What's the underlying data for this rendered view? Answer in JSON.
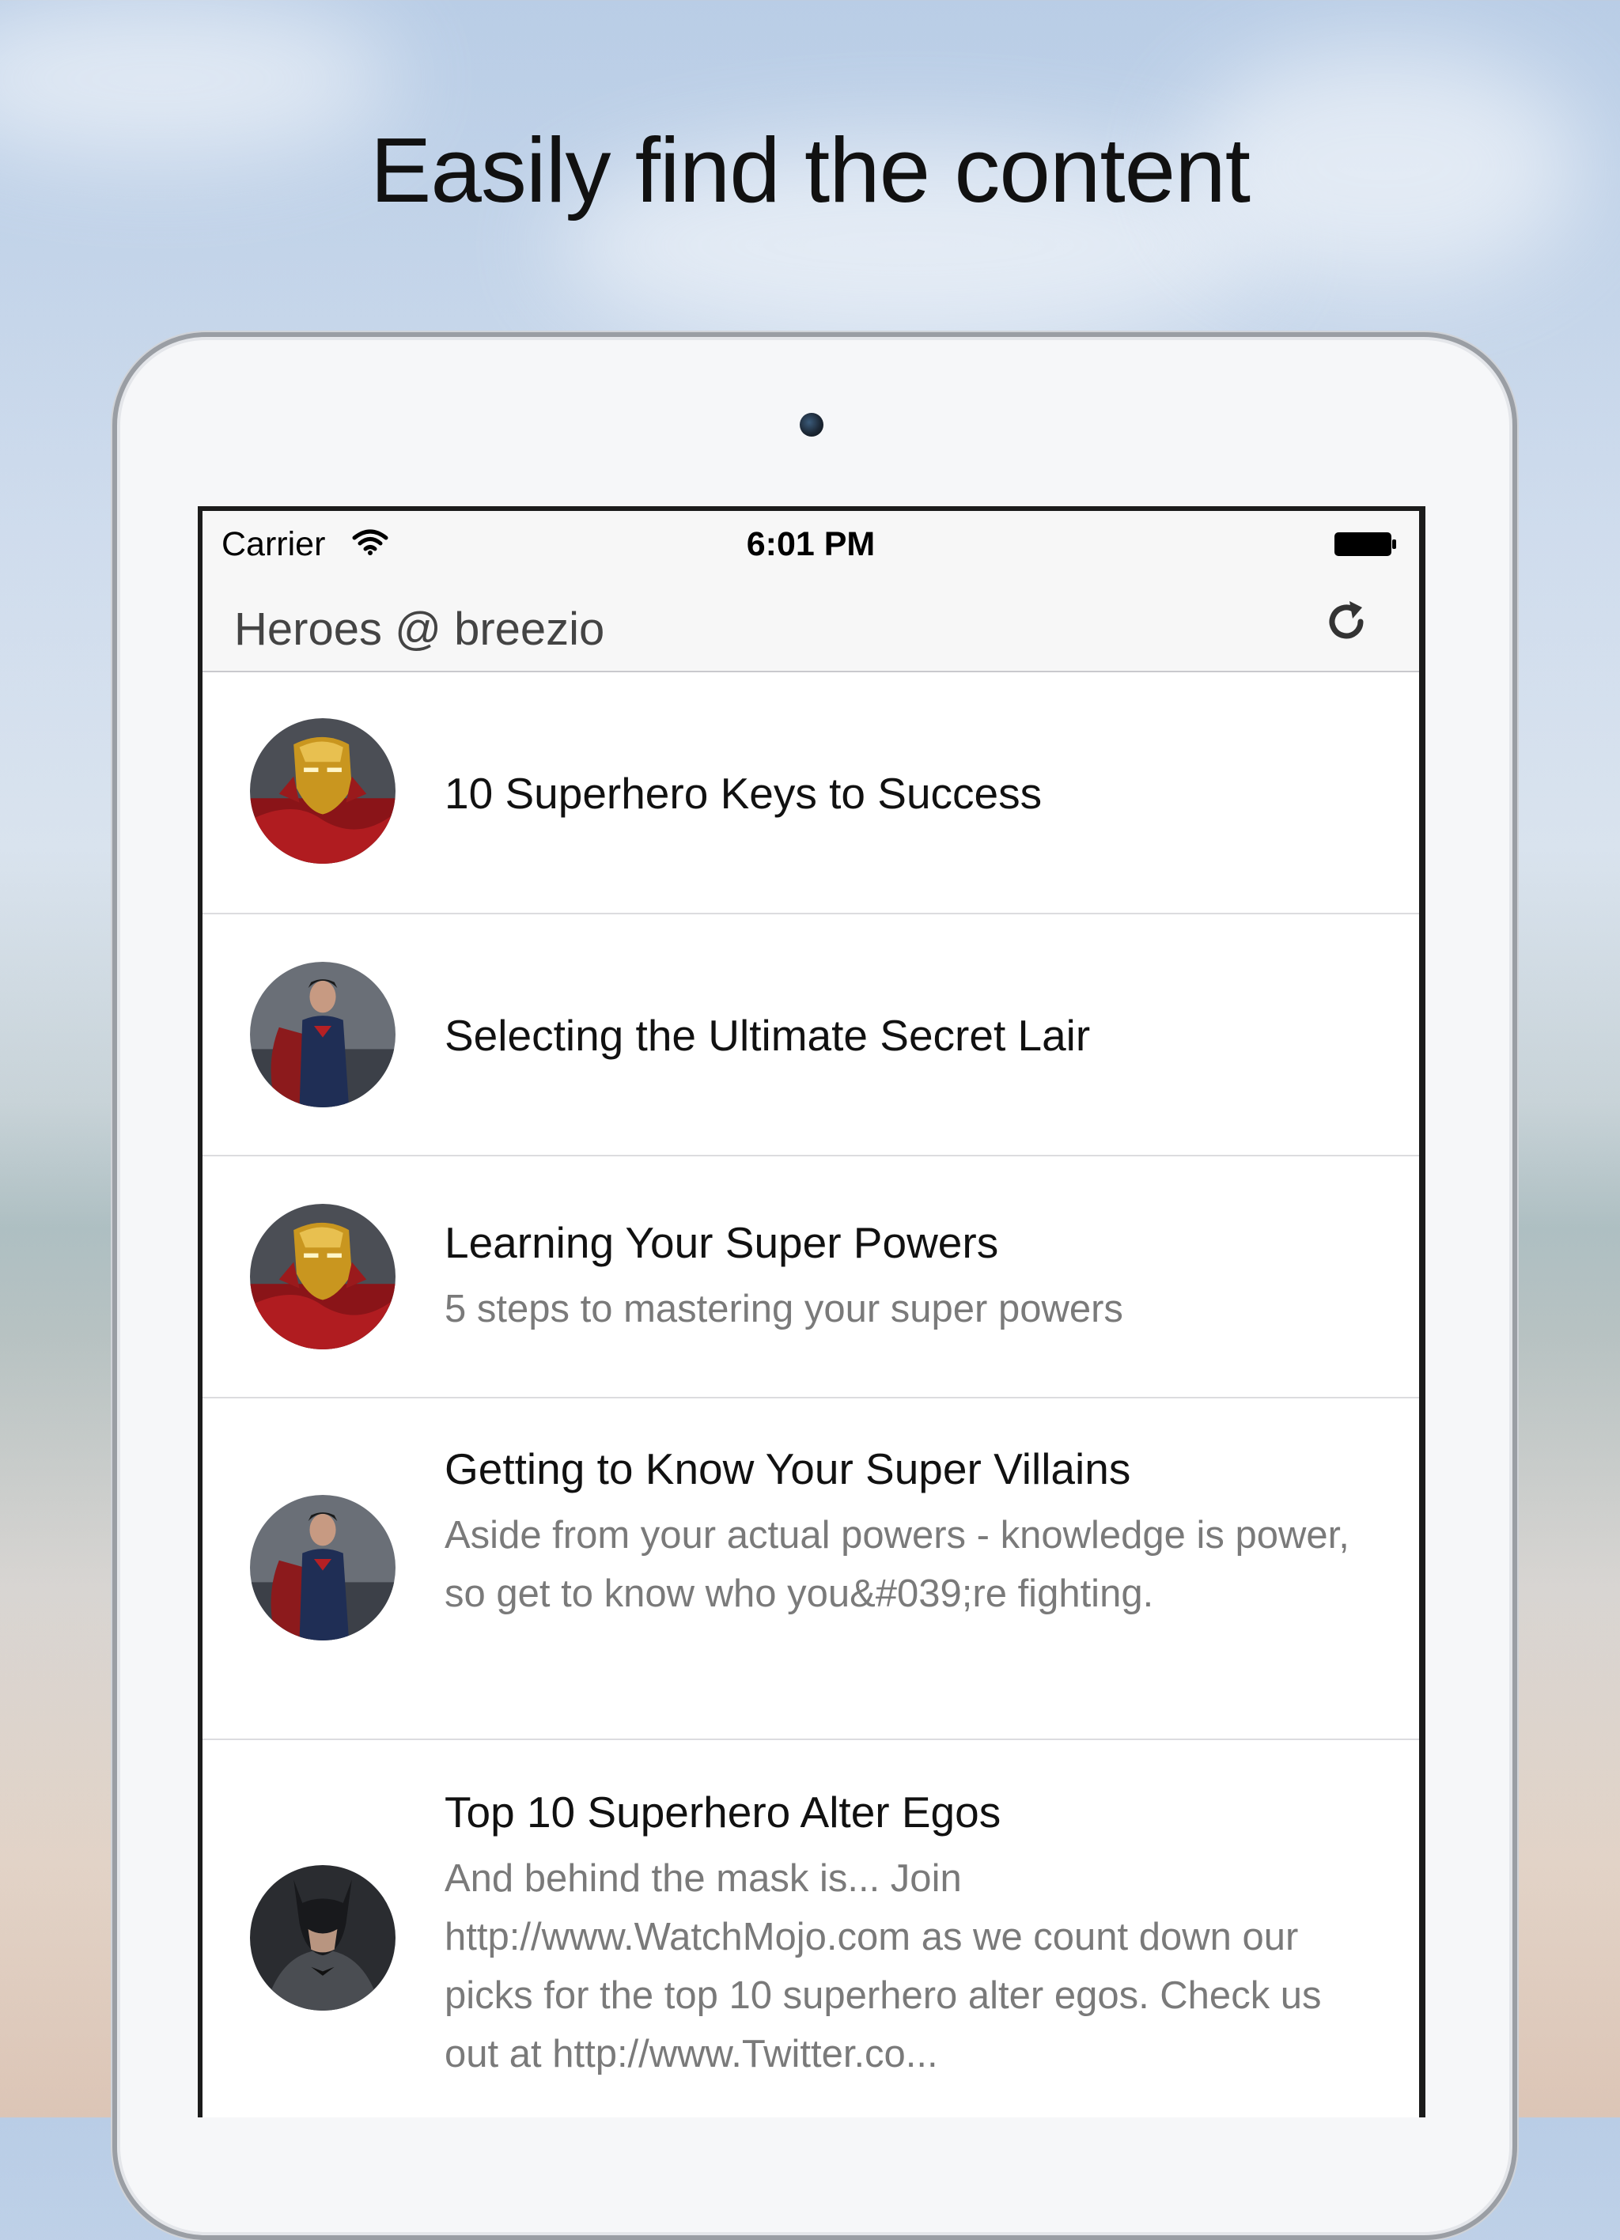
{
  "headline": "Easily find the content",
  "status_bar": {
    "carrier": "Carrier",
    "time": "6:01 PM"
  },
  "nav": {
    "title": "Heroes @ breezio",
    "refresh_icon": "refresh-icon"
  },
  "items": [
    {
      "title": "10 Superhero Keys to Success",
      "subtitle": "",
      "avatar": "iron-man"
    },
    {
      "title": "Selecting the Ultimate Secret Lair",
      "subtitle": "",
      "avatar": "superman"
    },
    {
      "title": "Learning Your Super Powers",
      "subtitle": "5 steps to mastering your super powers",
      "avatar": "iron-man"
    },
    {
      "title": "Getting to Know Your Super Villains",
      "subtitle": "Aside from your actual powers - knowledge is power, so get to know who you&#039;re fighting.",
      "avatar": "superman"
    },
    {
      "title": "Top 10 Superhero Alter Egos",
      "subtitle": "And behind the mask is... Join http://www.WatchMojo.com as we count down our picks for the top 10 superhero alter egos. Check us out at http://www.Twitter.co...",
      "avatar": "batman"
    }
  ],
  "colors": {
    "nav_background": "#f7f7f7",
    "title_text": "#111111",
    "subtitle_text": "#7a7a7a",
    "separator": "#dcdcdf"
  }
}
